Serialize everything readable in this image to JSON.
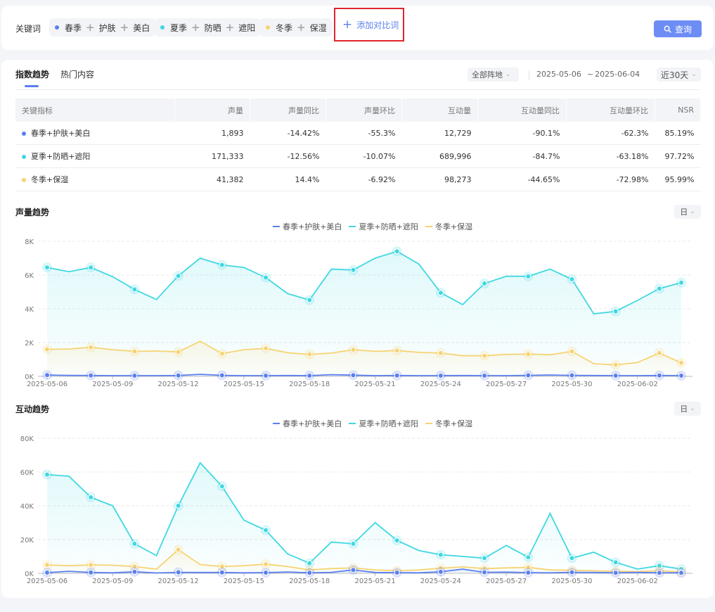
{
  "colors": {
    "blue": "#5b7ff0",
    "cyan": "#3fd8e2",
    "yellow": "#f7d373",
    "accent": "#6d8df5"
  },
  "filter_bar": {
    "keyword_label": "关键词",
    "groups": [
      {
        "color": "#5b7ff0",
        "terms": [
          "春季",
          "护肤",
          "美白"
        ]
      },
      {
        "color": "#3fd8e2",
        "terms": [
          "夏季",
          "防晒",
          "遮阳"
        ]
      },
      {
        "color": "#f7d373",
        "terms": [
          "冬季",
          "保湿"
        ]
      }
    ],
    "add_label": "添加对比词",
    "query_label": "查询"
  },
  "tabs": [
    "指数趋势",
    "热门内容"
  ],
  "region_select": "全部阵地",
  "date_start": "2025-05-06",
  "date_tilde": "~",
  "date_end": "2025-06-04",
  "range_select": "近30天",
  "table": {
    "headers": [
      "关键指标",
      "声量",
      "声量同比",
      "声量环比",
      "互动量",
      "互动量同比",
      "互动量环比",
      "NSR"
    ],
    "rows": [
      {
        "color": "#5b7ff0",
        "cells": [
          "春季+护肤+美白",
          "1,893",
          "-14.42%",
          "-55.3%",
          "12,729",
          "-90.1%",
          "-62.3%",
          "85.19%"
        ]
      },
      {
        "color": "#3fd8e2",
        "cells": [
          "夏季+防晒+遮阳",
          "171,333",
          "-12.56%",
          "-10.07%",
          "689,996",
          "-84.7%",
          "-63.18%",
          "97.72%"
        ]
      },
      {
        "color": "#f7d373",
        "cells": [
          "冬季+保湿",
          "41,382",
          "14.4%",
          "-6.92%",
          "98,273",
          "-44.65%",
          "-72.98%",
          "95.99%"
        ]
      }
    ]
  },
  "unit_select": "日",
  "chart_data": [
    {
      "type": "area",
      "title": "声量趋势",
      "x": [
        "2025-05-06",
        "2025-05-07",
        "2025-05-08",
        "2025-05-09",
        "2025-05-10",
        "2025-05-11",
        "2025-05-12",
        "2025-05-13",
        "2025-05-14",
        "2025-05-15",
        "2025-05-16",
        "2025-05-17",
        "2025-05-18",
        "2025-05-19",
        "2025-05-20",
        "2025-05-21",
        "2025-05-22",
        "2025-05-23",
        "2025-05-24",
        "2025-05-25",
        "2025-05-26",
        "2025-05-27",
        "2025-05-28",
        "2025-05-29",
        "2025-05-30",
        "2025-05-31",
        "2025-06-01",
        "2025-06-02",
        "2025-06-03",
        "2025-06-04"
      ],
      "tick_labels": [
        "2025-05-06",
        "2025-05-09",
        "2025-05-12",
        "2025-05-15",
        "2025-05-18",
        "2025-05-21",
        "2025-05-24",
        "2025-05-27",
        "2025-05-30",
        "2025-06-02"
      ],
      "y_ticks": [
        "0K",
        "2K",
        "4K",
        "6K",
        "8K"
      ],
      "ylim": [
        0,
        8000
      ],
      "series": [
        {
          "name": "春季+护肤+美白",
          "color": "#5b7ff0",
          "values": [
            80,
            60,
            50,
            40,
            40,
            40,
            50,
            120,
            60,
            40,
            40,
            50,
            40,
            100,
            70,
            40,
            50,
            40,
            40,
            50,
            40,
            40,
            60,
            80,
            60,
            50,
            40,
            40,
            50,
            40
          ]
        },
        {
          "name": "夏季+防晒+遮阳",
          "color": "#3fd8e2",
          "values": [
            6450,
            6200,
            6450,
            5900,
            5150,
            4550,
            5950,
            7000,
            6600,
            6450,
            5850,
            4900,
            4520,
            6350,
            6300,
            7000,
            7400,
            6650,
            4950,
            4250,
            5500,
            5930,
            5920,
            6350,
            5750,
            3700,
            3850,
            4500,
            5200,
            5550
          ]
        },
        {
          "name": "冬季+保湿",
          "color": "#f7d373",
          "values": [
            1600,
            1620,
            1720,
            1580,
            1480,
            1500,
            1450,
            2080,
            1350,
            1580,
            1660,
            1400,
            1300,
            1380,
            1580,
            1480,
            1530,
            1420,
            1380,
            1220,
            1220,
            1300,
            1320,
            1280,
            1480,
            750,
            680,
            820,
            1380,
            800
          ]
        }
      ]
    },
    {
      "type": "area",
      "title": "互动趋势",
      "x": [
        "2025-05-06",
        "2025-05-07",
        "2025-05-08",
        "2025-05-09",
        "2025-05-10",
        "2025-05-11",
        "2025-05-12",
        "2025-05-13",
        "2025-05-14",
        "2025-05-15",
        "2025-05-16",
        "2025-05-17",
        "2025-05-18",
        "2025-05-19",
        "2025-05-20",
        "2025-05-21",
        "2025-05-22",
        "2025-05-23",
        "2025-05-24",
        "2025-05-25",
        "2025-05-26",
        "2025-05-27",
        "2025-05-28",
        "2025-05-29",
        "2025-05-30",
        "2025-05-31",
        "2025-06-01",
        "2025-06-02",
        "2025-06-03",
        "2025-06-04"
      ],
      "tick_labels": [
        "2025-05-06",
        "2025-05-09",
        "2025-05-12",
        "2025-05-15",
        "2025-05-18",
        "2025-05-21",
        "2025-05-24",
        "2025-05-27",
        "2025-05-30",
        "2025-06-02"
      ],
      "y_ticks": [
        "0K",
        "20K",
        "40K",
        "60K",
        "80K"
      ],
      "ylim": [
        0,
        80000
      ],
      "series": [
        {
          "name": "春季+护肤+美白",
          "color": "#5b7ff0",
          "values": [
            400,
            1200,
            500,
            300,
            900,
            200,
            600,
            500,
            500,
            300,
            400,
            800,
            300,
            600,
            2000,
            500,
            400,
            300,
            900,
            2500,
            600,
            700,
            400,
            300,
            600,
            500,
            300,
            600,
            300,
            300
          ]
        },
        {
          "name": "夏季+防晒+遮阳",
          "color": "#3fd8e2",
          "values": [
            58500,
            57500,
            45000,
            40000,
            17500,
            10500,
            40000,
            65500,
            51500,
            31500,
            25500,
            11500,
            6000,
            18500,
            17500,
            30000,
            19500,
            13500,
            11000,
            10000,
            9000,
            16500,
            9500,
            35500,
            9000,
            12500,
            6500,
            2500,
            4500,
            2500
          ]
        },
        {
          "name": "冬季+保湿",
          "color": "#f7d373",
          "values": [
            5000,
            4500,
            5000,
            4800,
            4000,
            2500,
            14000,
            5200,
            4000,
            4500,
            5400,
            4000,
            2000,
            2800,
            3200,
            2000,
            1500,
            2000,
            3000,
            3800,
            2800,
            3200,
            3500,
            2000,
            1800,
            1500,
            1200,
            1000,
            1500,
            800
          ]
        }
      ]
    }
  ]
}
